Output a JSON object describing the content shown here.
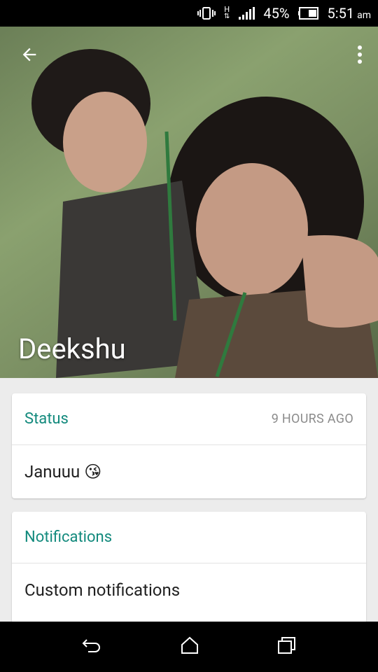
{
  "status_bar": {
    "network": "H",
    "battery": "45%",
    "time": "5:51",
    "ampm": "am"
  },
  "header": {
    "contact_name": "Deekshu"
  },
  "status_card": {
    "title": "Status",
    "time_ago": "9 HOURS AGO",
    "status_text": "Januuu 😘"
  },
  "notifications_card": {
    "title": "Notifications",
    "custom_notifications": "Custom notifications"
  },
  "colors": {
    "accent": "#138a7d",
    "background": "#ececec"
  },
  "icons": [
    "back-arrow-icon",
    "overflow-menu-icon",
    "vibrate-icon",
    "signal-icon",
    "battery-icon",
    "nav-back-icon",
    "nav-home-icon",
    "nav-recents-icon"
  ]
}
